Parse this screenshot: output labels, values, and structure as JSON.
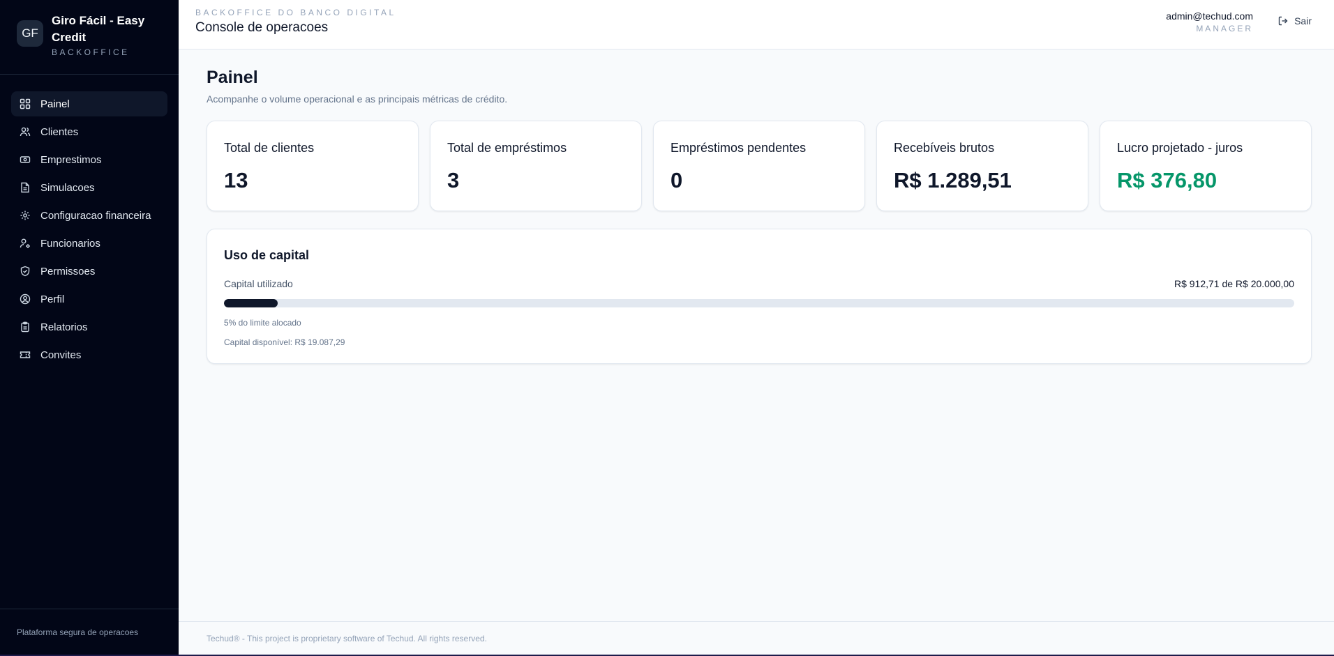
{
  "brand": {
    "initials": "GF",
    "name": "Giro Fácil - Easy Credit",
    "subtitle": "BACKOFFICE"
  },
  "sidebar": {
    "items": [
      {
        "label": "Painel",
        "icon": "grid-icon",
        "active": true
      },
      {
        "label": "Clientes",
        "icon": "users-icon",
        "active": false
      },
      {
        "label": "Emprestimos",
        "icon": "banknote-icon",
        "active": false
      },
      {
        "label": "Simulacoes",
        "icon": "file-text-icon",
        "active": false
      },
      {
        "label": "Configuracao financeira",
        "icon": "settings-icon",
        "active": false
      },
      {
        "label": "Funcionarios",
        "icon": "user-cog-icon",
        "active": false
      },
      {
        "label": "Permissoes",
        "icon": "shield-check-icon",
        "active": false
      },
      {
        "label": "Perfil",
        "icon": "user-circle-icon",
        "active": false
      },
      {
        "label": "Relatorios",
        "icon": "clipboard-icon",
        "active": false
      },
      {
        "label": "Convites",
        "icon": "ticket-icon",
        "active": false
      }
    ],
    "footer": "Plataforma segura de operacoes"
  },
  "header": {
    "kicker": "BACKOFFICE DO BANCO DIGITAL",
    "title": "Console de operacoes",
    "user_email": "admin@techud.com",
    "user_role": "MANAGER",
    "logout_label": "Sair"
  },
  "main": {
    "title": "Painel",
    "description": "Acompanhe o volume operacional e as principais métricas de crédito.",
    "cards": [
      {
        "label": "Total de clientes",
        "value": "13"
      },
      {
        "label": "Total de empréstimos",
        "value": "3"
      },
      {
        "label": "Empréstimos pendentes",
        "value": "0"
      },
      {
        "label": "Recebíveis brutos",
        "value": "R$ 1.289,51"
      },
      {
        "label": "Lucro projetado - juros",
        "value": "R$ 376,80"
      }
    ],
    "capital": {
      "title": "Uso de capital",
      "used_label": "Capital utilizado",
      "used_amount": "R$ 912,71 de R$ 20.000,00",
      "progress_percent": 5,
      "allocated_note": "5% do limite alocado",
      "available_note": "Capital disponível: R$ 19.087,29"
    }
  },
  "footer": {
    "text": "Techud® - This project is proprietary software of Techud. All rights reserved."
  },
  "colors": {
    "sidebar_bg": "#020617",
    "accent_green": "#059669",
    "progress_fill": "#0f172a",
    "progress_track": "#e2e8f0"
  }
}
